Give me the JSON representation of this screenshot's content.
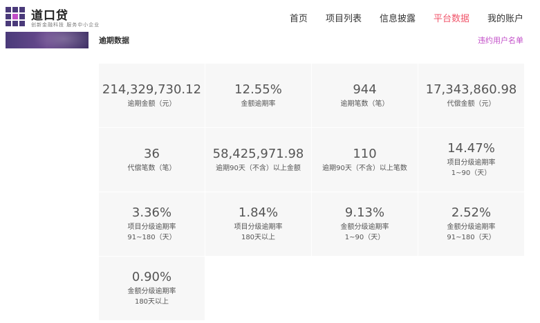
{
  "brand": {
    "name": "道口贷",
    "slogan": "创新金融科技  服务中小企业",
    "colors": {
      "purple": "#4a3a7a"
    }
  },
  "nav": {
    "items": [
      {
        "label": "首页"
      },
      {
        "label": "项目列表"
      },
      {
        "label": "信息披露"
      },
      {
        "label": "平台数据",
        "active": true
      },
      {
        "label": "我的账户"
      }
    ],
    "active_color": "#f0566b"
  },
  "section": {
    "title": "逾期数据",
    "blacklist_link": "违约用户名单",
    "link_color": "#c24ec8"
  },
  "stats": [
    {
      "value": "214,329,730.12",
      "label": "逾期金额（元）",
      "sub": ""
    },
    {
      "value": "12.55%",
      "label": "金额逾期率",
      "sub": ""
    },
    {
      "value": "944",
      "label": "逾期笔数（笔）",
      "sub": ""
    },
    {
      "value": "17,343,860.98",
      "label": "代偿金额（元）",
      "sub": ""
    },
    {
      "value": "36",
      "label": "代偿笔数（笔）",
      "sub": ""
    },
    {
      "value": "58,425,971.98",
      "label": "逾期90天（不含）以上金额",
      "sub": ""
    },
    {
      "value": "110",
      "label": "逾期90天（不含）以上笔数",
      "sub": ""
    },
    {
      "value": "14.47%",
      "label": "项目分级逾期率",
      "sub": "1~90（天）"
    },
    {
      "value": "3.36%",
      "label": "项目分级逾期率",
      "sub": "91~180（天）"
    },
    {
      "value": "1.84%",
      "label": "项目分级逾期率",
      "sub": "180天以上"
    },
    {
      "value": "9.13%",
      "label": "金额分级逾期率",
      "sub": "1~90（天）"
    },
    {
      "value": "2.52%",
      "label": "金额分级逾期率",
      "sub": "91~180（天）"
    },
    {
      "value": "0.90%",
      "label": "金额分级逾期率",
      "sub": "180天以上"
    }
  ]
}
